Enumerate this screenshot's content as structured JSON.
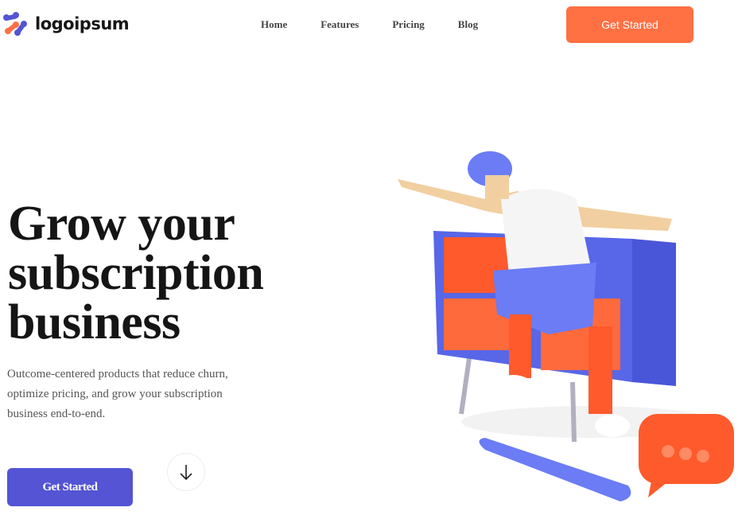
{
  "header": {
    "logo_text": "logoipsum",
    "nav": [
      "Home",
      "Features",
      "Pricing",
      "Blog"
    ],
    "cta": "Get Started"
  },
  "hero": {
    "title": "Grow your subscription business",
    "subtitle": "Outcome-centered products that reduce churn, optimize pricing, and grow your subscription business end-to-end.",
    "cta": "Get Started"
  },
  "colors": {
    "accent": "#ff7043",
    "primary": "#5454d4"
  }
}
